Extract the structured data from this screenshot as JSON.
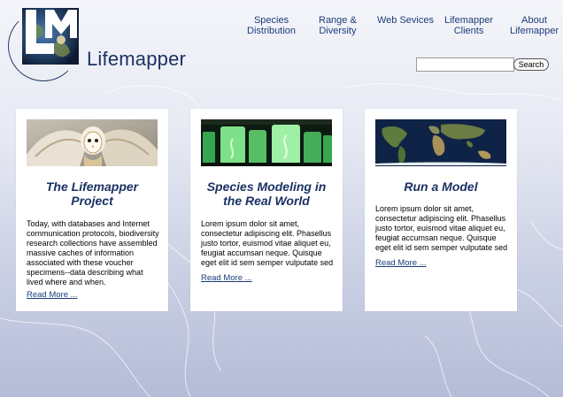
{
  "logo": {
    "letters": "LM",
    "name": "Lifemapper"
  },
  "nav": [
    {
      "line1": "Species",
      "line2": "Distribution"
    },
    {
      "line1": "Range &",
      "line2": "Diversity"
    },
    {
      "line1": "Web Sevices",
      "line2": ""
    },
    {
      "line1": "Lifemapper",
      "line2": "Clients"
    },
    {
      "line1": "About",
      "line2": "Lifemapper"
    }
  ],
  "search": {
    "value": "",
    "button_label": "Search"
  },
  "cards": [
    {
      "image": "barn-owl-photo",
      "title_line1": "The Lifemapper",
      "title_line2": "Project",
      "body": "Today, with databases and Internet communication protocols, biodiversity research collections have assembled massive caches of information associated with these voucher specimens--data describing what lived where and when.",
      "link": "Read More ..."
    },
    {
      "image": "specimen-jars-photo",
      "title_line1": "Species Modeling in",
      "title_line2": "the Real World",
      "body": "Lorem ipsum dolor sit amet, consectetur adipiscing elit. Phasellus justo tortor, euismod vitae aliquet eu, feugiat accumsan neque. Quisque eget elit id sem semper vulputate sed",
      "link": "Read More ..."
    },
    {
      "image": "world-map-photo",
      "title_line1": "Run a Model",
      "title_line2": "",
      "body": "Lorem ipsum dolor sit amet, consectetur adipiscing elit. Phasellus justo tortor, euismod vitae aliquet eu, feugiat accumsan neque. Quisque eget elit id sem semper vulputate sed",
      "link": "Read More ..."
    }
  ],
  "colors": {
    "brand": "#1b3263",
    "link": "#1a3c7a"
  }
}
